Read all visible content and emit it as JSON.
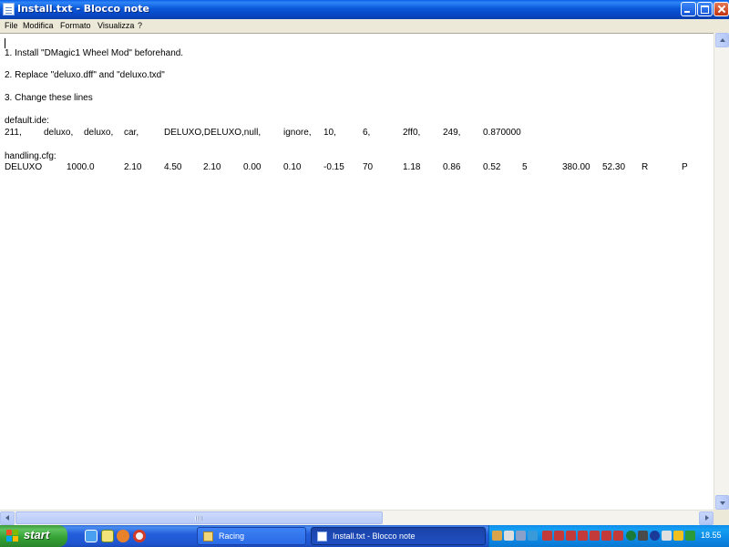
{
  "window": {
    "title": "Install.txt - Blocco note"
  },
  "menu": {
    "items": [
      "File",
      "Modifica",
      "Formato",
      "Visualizza",
      "?"
    ]
  },
  "editor": {
    "lines": {
      "l1": "1. Install \"DMagic1 Wheel Mod\" beforehand.",
      "l2": "2. Replace \"deluxo.dff\" and \"deluxo.txd\"",
      "l3": "3. Change these lines",
      "ide_header": "default.ide:",
      "handling_header": "handling.cfg:"
    },
    "ide_row": [
      "211,",
      "deluxo,",
      "deluxo,",
      "car,",
      "DELUXO,DELUXO,null,",
      "ignore,",
      "10,",
      "6,",
      "2ff0,",
      "249,",
      "0.870000"
    ],
    "handling_row": [
      "DELUXO",
      "1000.0",
      "2.10",
      "4.50",
      "2.10",
      "0.00",
      "0.10",
      "-0.15",
      "70",
      "1.18",
      "0.86",
      "0.52",
      "5",
      "380.00",
      "52.30",
      "R",
      "P"
    ]
  },
  "taskbar": {
    "start_label": "start",
    "tasks": [
      "Racing",
      "Install.txt - Blocco note"
    ],
    "clock": "18.55"
  },
  "colors": {
    "titlebar": "#0a58da",
    "taskbar": "#245edb",
    "start": "#36a336",
    "tray": "#0f8bea"
  }
}
